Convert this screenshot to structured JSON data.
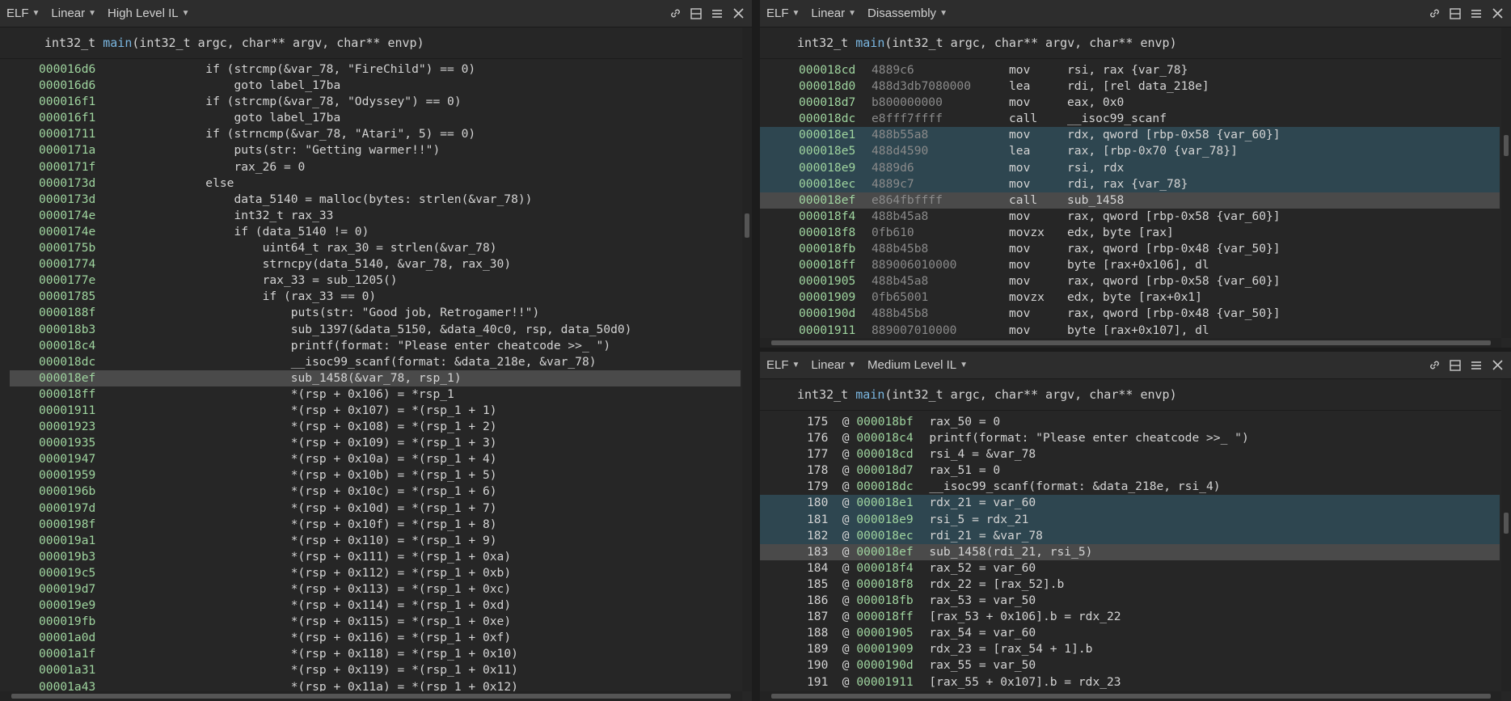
{
  "hlil_pane": {
    "toolbar": {
      "file": "ELF",
      "layout": "Linear",
      "view": "High Level IL"
    },
    "signature": {
      "ret": "int32_t",
      "name": "main",
      "params": "(int32_t argc, char** argv, char** envp)"
    },
    "lines": [
      {
        "addr": "000016d6",
        "indent": "        ",
        "text": "if (strcmp(&var_78, \"FireChild\") == 0)"
      },
      {
        "addr": "000016d6",
        "indent": "            ",
        "text": "goto label_17ba"
      },
      {
        "addr": "000016f1",
        "indent": "        ",
        "text": "if (strcmp(&var_78, \"Odyssey\") == 0)"
      },
      {
        "addr": "000016f1",
        "indent": "            ",
        "text": "goto label_17ba"
      },
      {
        "addr": "00001711",
        "indent": "        ",
        "text": "if (strncmp(&var_78, \"Atari\", 5) == 0)"
      },
      {
        "addr": "0000171a",
        "indent": "            ",
        "text": "puts(str: \"Getting warmer!!\")"
      },
      {
        "addr": "0000171f",
        "indent": "            ",
        "text": "rax_26 = 0"
      },
      {
        "addr": "0000173d",
        "indent": "        ",
        "text": "else"
      },
      {
        "addr": "0000173d",
        "indent": "            ",
        "text": "data_5140 = malloc(bytes: strlen(&var_78))"
      },
      {
        "addr": "0000174e",
        "indent": "            ",
        "text": "int32_t rax_33"
      },
      {
        "addr": "0000174e",
        "indent": "            ",
        "text": "if (data_5140 != 0)"
      },
      {
        "addr": "0000175b",
        "indent": "                ",
        "text": "uint64_t rax_30 = strlen(&var_78)"
      },
      {
        "addr": "00001774",
        "indent": "                ",
        "text": "strncpy(data_5140, &var_78, rax_30)"
      },
      {
        "addr": "0000177e",
        "indent": "                ",
        "text": "rax_33 = sub_1205()"
      },
      {
        "addr": "00001785",
        "indent": "                ",
        "text": "if (rax_33 == 0)"
      },
      {
        "addr": "0000188f",
        "indent": "                    ",
        "text": "puts(str: \"Good job, Retrogamer!!\")"
      },
      {
        "addr": "000018b3",
        "indent": "                    ",
        "text": "sub_1397(&data_5150, &data_40c0, rsp, data_50d0)"
      },
      {
        "addr": "000018c4",
        "indent": "                    ",
        "text": "printf(format: \"Please enter cheatcode >>_ \")"
      },
      {
        "addr": "000018dc",
        "indent": "                    ",
        "text": "__isoc99_scanf(format: &data_218e, &var_78)"
      },
      {
        "addr": "000018ef",
        "indent": "                    ",
        "text": "sub_1458(&var_78, rsp_1)",
        "sel": true
      },
      {
        "addr": "000018ff",
        "indent": "                    ",
        "text": "*(rsp + 0x106) = *rsp_1"
      },
      {
        "addr": "00001911",
        "indent": "                    ",
        "text": "*(rsp + 0x107) = *(rsp_1 + 1)"
      },
      {
        "addr": "00001923",
        "indent": "                    ",
        "text": "*(rsp + 0x108) = *(rsp_1 + 2)"
      },
      {
        "addr": "00001935",
        "indent": "                    ",
        "text": "*(rsp + 0x109) = *(rsp_1 + 3)"
      },
      {
        "addr": "00001947",
        "indent": "                    ",
        "text": "*(rsp + 0x10a) = *(rsp_1 + 4)"
      },
      {
        "addr": "00001959",
        "indent": "                    ",
        "text": "*(rsp + 0x10b) = *(rsp_1 + 5)"
      },
      {
        "addr": "0000196b",
        "indent": "                    ",
        "text": "*(rsp + 0x10c) = *(rsp_1 + 6)"
      },
      {
        "addr": "0000197d",
        "indent": "                    ",
        "text": "*(rsp + 0x10d) = *(rsp_1 + 7)"
      },
      {
        "addr": "0000198f",
        "indent": "                    ",
        "text": "*(rsp + 0x10f) = *(rsp_1 + 8)"
      },
      {
        "addr": "000019a1",
        "indent": "                    ",
        "text": "*(rsp + 0x110) = *(rsp_1 + 9)"
      },
      {
        "addr": "000019b3",
        "indent": "                    ",
        "text": "*(rsp + 0x111) = *(rsp_1 + 0xa)"
      },
      {
        "addr": "000019c5",
        "indent": "                    ",
        "text": "*(rsp + 0x112) = *(rsp_1 + 0xb)"
      },
      {
        "addr": "000019d7",
        "indent": "                    ",
        "text": "*(rsp + 0x113) = *(rsp_1 + 0xc)"
      },
      {
        "addr": "000019e9",
        "indent": "                    ",
        "text": "*(rsp + 0x114) = *(rsp_1 + 0xd)"
      },
      {
        "addr": "000019fb",
        "indent": "                    ",
        "text": "*(rsp + 0x115) = *(rsp_1 + 0xe)"
      },
      {
        "addr": "00001a0d",
        "indent": "                    ",
        "text": "*(rsp + 0x116) = *(rsp_1 + 0xf)"
      },
      {
        "addr": "00001a1f",
        "indent": "                    ",
        "text": "*(rsp + 0x118) = *(rsp_1 + 0x10)"
      },
      {
        "addr": "00001a31",
        "indent": "                    ",
        "text": "*(rsp + 0x119) = *(rsp_1 + 0x11)"
      },
      {
        "addr": "00001a43",
        "indent": "                    ",
        "text": "*(rsp + 0x11a) = *(rsp_1 + 0x12)"
      }
    ]
  },
  "disasm_pane": {
    "toolbar": {
      "file": "ELF",
      "layout": "Linear",
      "view": "Disassembly"
    },
    "signature": {
      "ret": "int32_t",
      "name": "main",
      "params": "(int32_t argc, char** argv, char** envp)"
    },
    "lines": [
      {
        "addr": "000018cd",
        "bytes": "4889c6",
        "mnem": "mov",
        "ops": "rsi, rax {var_78}"
      },
      {
        "addr": "000018d0",
        "bytes": "488d3db7080000",
        "mnem": "lea",
        "ops": "rdi, [rel data_218e]"
      },
      {
        "addr": "000018d7",
        "bytes": "b800000000",
        "mnem": "mov",
        "ops": "eax, 0x0"
      },
      {
        "addr": "000018dc",
        "bytes": "e8fff7ffff",
        "mnem": "call",
        "ops": "__isoc99_scanf"
      },
      {
        "addr": "000018e1",
        "bytes": "488b55a8",
        "mnem": "mov",
        "ops": "rdx, qword [rbp-0x58 {var_60}]",
        "hl": true
      },
      {
        "addr": "000018e5",
        "bytes": "488d4590",
        "mnem": "lea",
        "ops": "rax, [rbp-0x70 {var_78}]",
        "hl": true
      },
      {
        "addr": "000018e9",
        "bytes": "4889d6",
        "mnem": "mov",
        "ops": "rsi, rdx",
        "hl": true
      },
      {
        "addr": "000018ec",
        "bytes": "4889c7",
        "mnem": "mov",
        "ops": "rdi, rax {var_78}",
        "hl": true
      },
      {
        "addr": "000018ef",
        "bytes": "e864fbffff",
        "mnem": "call",
        "ops": "sub_1458",
        "sel": true
      },
      {
        "addr": "000018f4",
        "bytes": "488b45a8",
        "mnem": "mov",
        "ops": "rax, qword [rbp-0x58 {var_60}]"
      },
      {
        "addr": "000018f8",
        "bytes": "0fb610",
        "mnem": "movzx",
        "ops": "edx, byte [rax]"
      },
      {
        "addr": "000018fb",
        "bytes": "488b45b8",
        "mnem": "mov",
        "ops": "rax, qword [rbp-0x48 {var_50}]"
      },
      {
        "addr": "000018ff",
        "bytes": "889006010000",
        "mnem": "mov",
        "ops": "byte [rax+0x106], dl"
      },
      {
        "addr": "00001905",
        "bytes": "488b45a8",
        "mnem": "mov",
        "ops": "rax, qword [rbp-0x58 {var_60}]"
      },
      {
        "addr": "00001909",
        "bytes": "0fb65001",
        "mnem": "movzx",
        "ops": "edx, byte [rax+0x1]"
      },
      {
        "addr": "0000190d",
        "bytes": "488b45b8",
        "mnem": "mov",
        "ops": "rax, qword [rbp-0x48 {var_50}]"
      },
      {
        "addr": "00001911",
        "bytes": "889007010000",
        "mnem": "mov",
        "ops": "byte [rax+0x107], dl"
      }
    ]
  },
  "mlil_pane": {
    "toolbar": {
      "file": "ELF",
      "layout": "Linear",
      "view": "Medium Level IL"
    },
    "signature": {
      "ret": "int32_t",
      "name": "main",
      "params": "(int32_t argc, char** argv, char** envp)"
    },
    "lines": [
      {
        "idx": "175",
        "addr": "000018bf",
        "text": "rax_50 = 0"
      },
      {
        "idx": "176",
        "addr": "000018c4",
        "text": "printf(format: \"Please enter cheatcode >>_ \")"
      },
      {
        "idx": "177",
        "addr": "000018cd",
        "text": "rsi_4 = &var_78"
      },
      {
        "idx": "178",
        "addr": "000018d7",
        "text": "rax_51 = 0"
      },
      {
        "idx": "179",
        "addr": "000018dc",
        "text": "__isoc99_scanf(format: &data_218e, rsi_4)"
      },
      {
        "idx": "180",
        "addr": "000018e1",
        "text": "rdx_21 = var_60",
        "hl": true
      },
      {
        "idx": "181",
        "addr": "000018e9",
        "text": "rsi_5 = rdx_21",
        "hl": true
      },
      {
        "idx": "182",
        "addr": "000018ec",
        "text": "rdi_21 = &var_78",
        "hl": true
      },
      {
        "idx": "183",
        "addr": "000018ef",
        "text": "sub_1458(rdi_21, rsi_5)",
        "sel": true
      },
      {
        "idx": "184",
        "addr": "000018f4",
        "text": "rax_52 = var_60"
      },
      {
        "idx": "185",
        "addr": "000018f8",
        "text": "rdx_22 = [rax_52].b"
      },
      {
        "idx": "186",
        "addr": "000018fb",
        "text": "rax_53 = var_50"
      },
      {
        "idx": "187",
        "addr": "000018ff",
        "text": "[rax_53 + 0x106].b = rdx_22"
      },
      {
        "idx": "188",
        "addr": "00001905",
        "text": "rax_54 = var_60"
      },
      {
        "idx": "189",
        "addr": "00001909",
        "text": "rdx_23 = [rax_54 + 1].b"
      },
      {
        "idx": "190",
        "addr": "0000190d",
        "text": "rax_55 = var_50"
      },
      {
        "idx": "191",
        "addr": "00001911",
        "text": "[rax_55 + 0x107].b = rdx_23"
      }
    ]
  },
  "icons": [
    "link-icon",
    "split-icon",
    "menu-icon",
    "close-icon"
  ],
  "colors": {
    "address": "#9fd49f",
    "function": "#7ab6e0",
    "selection": "#4a4a4a",
    "highlight": "#2e4650",
    "background": "#262626"
  }
}
